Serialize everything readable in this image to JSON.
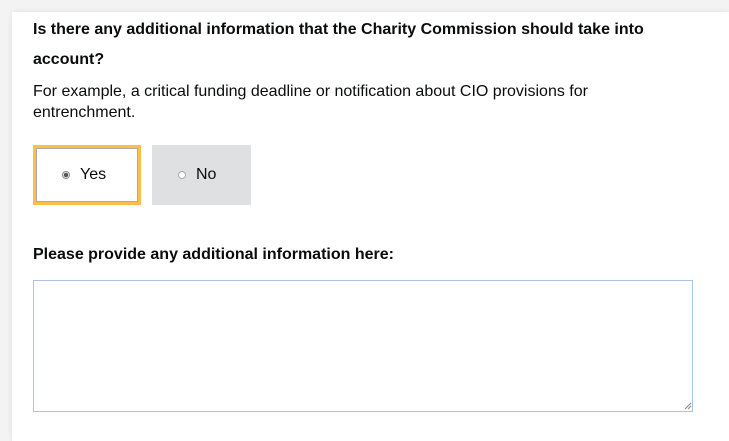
{
  "question": {
    "title": "Is there any additional information that the Charity Commission should take into account?",
    "hint": "For example, a critical funding deadline or notification about CIO provisions for entrenchment."
  },
  "options": [
    {
      "label": "Yes",
      "selected": true
    },
    {
      "label": "No",
      "selected": false
    }
  ],
  "details": {
    "label": "Please provide any additional information here:",
    "value": ""
  },
  "colors": {
    "focus": "#ffbf47",
    "unselected_bg": "#dee0e2",
    "textarea_border": "#a8c6df"
  }
}
